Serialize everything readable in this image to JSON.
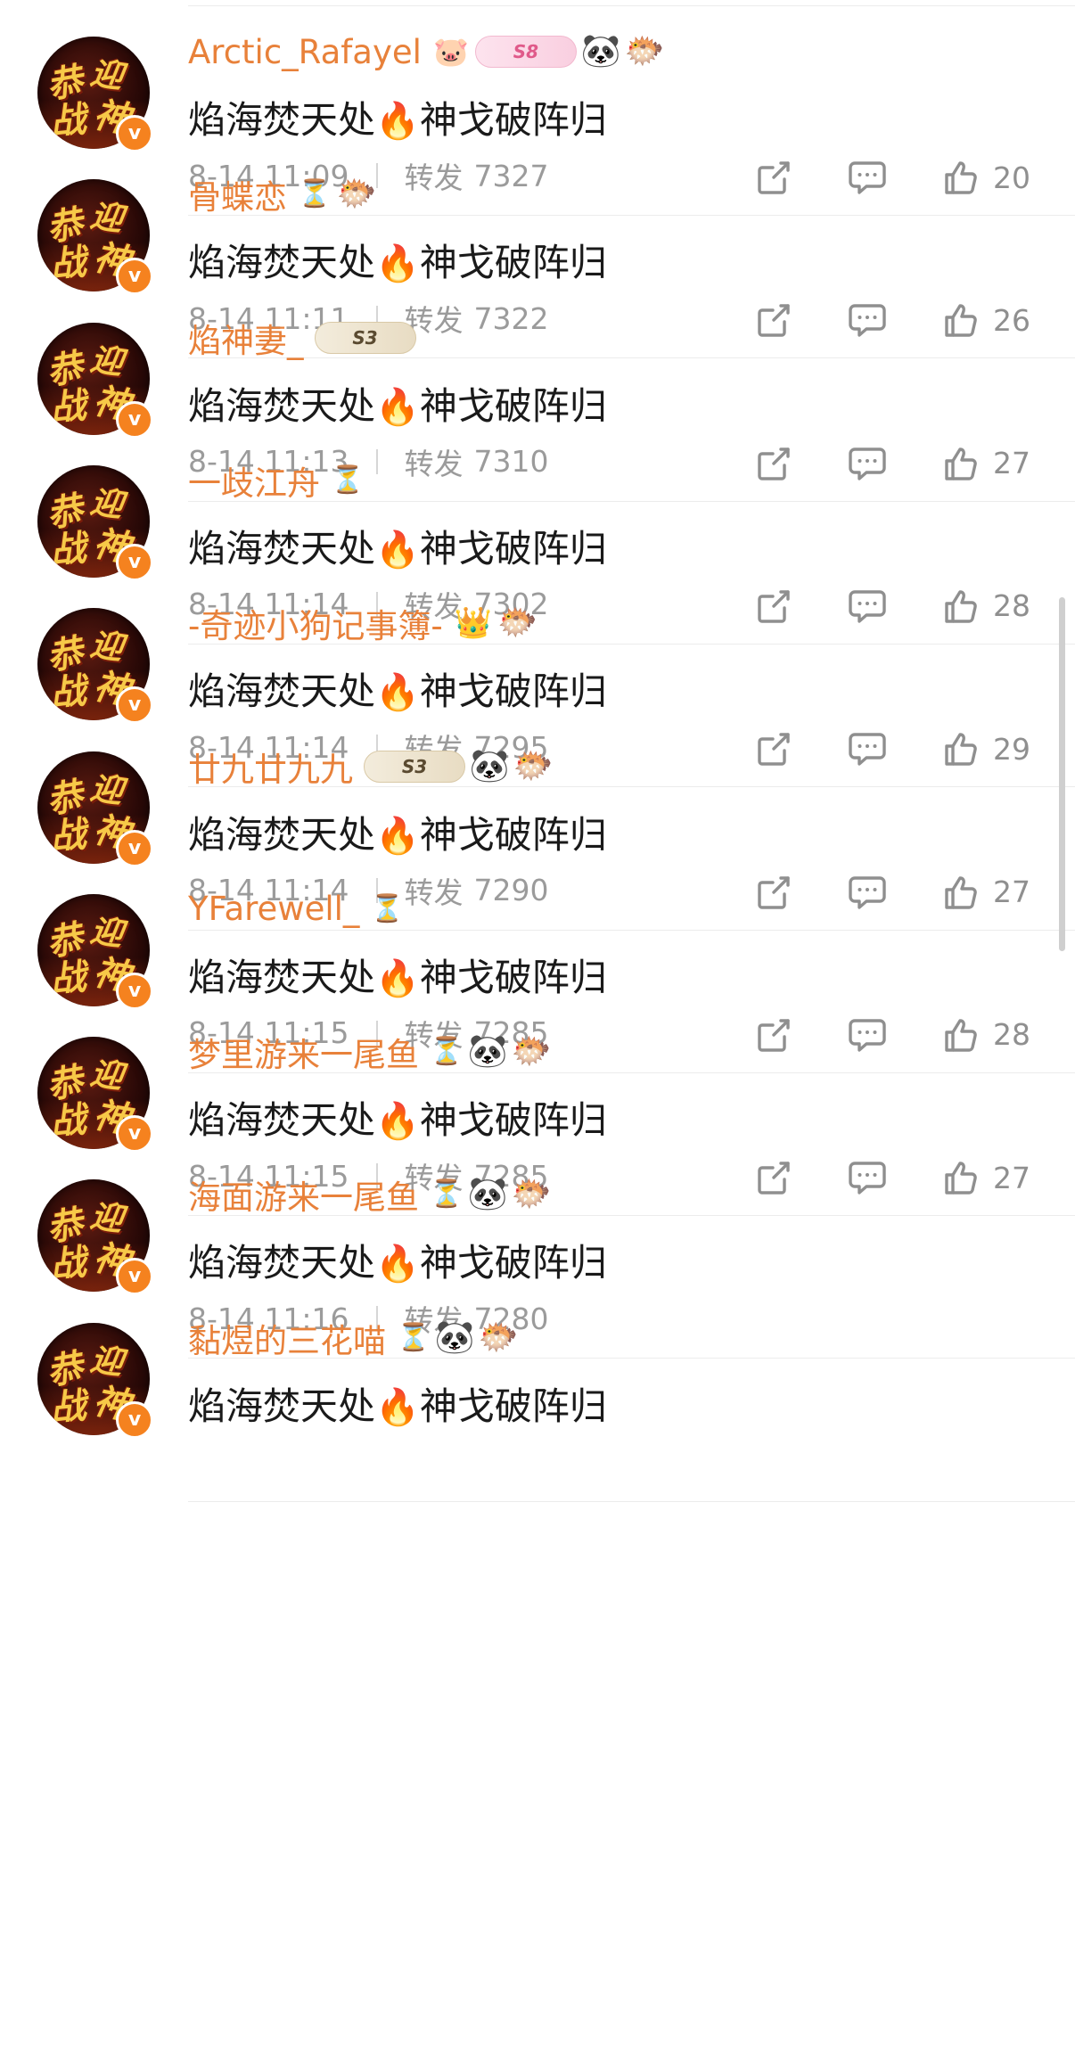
{
  "content_text": "焰海焚天处",
  "content_emoji": "🔥",
  "content_text2": "神戈破阵归",
  "repost_label": "转发",
  "avatar_text": [
    "恭",
    "迎",
    "战",
    "神"
  ],
  "verified_mark": "v",
  "accent_color": "#e8813a",
  "comments": [
    {
      "username": "Arctic_Rafayel",
      "badges": [
        {
          "type": "level",
          "label": "S8",
          "style": "pink",
          "icon": "kiss-icon"
        },
        {
          "type": "panda",
          "icon": "panda-icon"
        },
        {
          "type": "fish",
          "icon": "pufferfish-icon"
        }
      ],
      "time": "8-14 11:09",
      "reposts": "7327",
      "likes": "20"
    },
    {
      "username": "骨蝶恋",
      "badges": [
        {
          "type": "hourglass",
          "icon": "hourglass-icon"
        },
        {
          "type": "fish",
          "icon": "blue-fish-icon"
        }
      ],
      "time": "8-14 11:11",
      "reposts": "7322",
      "likes": "26"
    },
    {
      "username": "焰神妻_",
      "badges": [
        {
          "type": "level",
          "label": "S3",
          "style": "gold",
          "icon": "level-s3-badge"
        }
      ],
      "time": "8-14 11:13",
      "reposts": "7310",
      "likes": "27"
    },
    {
      "username": "一歧江舟",
      "badges": [
        {
          "type": "hourglass",
          "icon": "hourglass-icon"
        }
      ],
      "time": "8-14 11:14",
      "reposts": "7302",
      "likes": "28"
    },
    {
      "username": "-奇迹小狗记事簿-",
      "badges": [
        {
          "type": "crown",
          "icon": "crown-icon"
        },
        {
          "type": "fish",
          "icon": "pufferfish-icon"
        }
      ],
      "time": "8-14 11:14",
      "reposts": "7295",
      "likes": "29"
    },
    {
      "username": "廿九廿九九",
      "badges": [
        {
          "type": "level",
          "label": "S3",
          "style": "gold",
          "icon": "level-s3-badge"
        },
        {
          "type": "panda",
          "icon": "panda-icon"
        },
        {
          "type": "fish",
          "icon": "pufferfish-icon"
        }
      ],
      "time": "8-14 11:14",
      "reposts": "7290",
      "likes": "27"
    },
    {
      "username": "YFarewell_",
      "badges": [
        {
          "type": "hourglass",
          "icon": "hourglass-icon"
        }
      ],
      "time": "8-14 11:15",
      "reposts": "7285",
      "likes": "28"
    },
    {
      "username": "梦里游来一尾鱼",
      "badges": [
        {
          "type": "hourglass",
          "icon": "hourglass-icon"
        },
        {
          "type": "panda",
          "icon": "panda-icon"
        },
        {
          "type": "fish",
          "icon": "pufferfish-icon"
        }
      ],
      "time": "8-14 11:15",
      "reposts": "7285",
      "likes": "27"
    },
    {
      "username": "海面游来一尾鱼",
      "badges": [
        {
          "type": "hourglass",
          "icon": "hourglass-icon"
        },
        {
          "type": "panda",
          "icon": "panda-icon"
        },
        {
          "type": "fish",
          "icon": "pufferfish-icon"
        }
      ],
      "time": "8-14 11:16",
      "reposts": "7280",
      "likes": ""
    },
    {
      "username": "黏煜的三花喵",
      "badges": [
        {
          "type": "hourglass",
          "icon": "hourglass-icon"
        },
        {
          "type": "panda",
          "icon": "panda-icon"
        },
        {
          "type": "fish",
          "icon": "pufferfish-icon"
        }
      ],
      "time": "",
      "reposts": "",
      "likes": ""
    }
  ]
}
